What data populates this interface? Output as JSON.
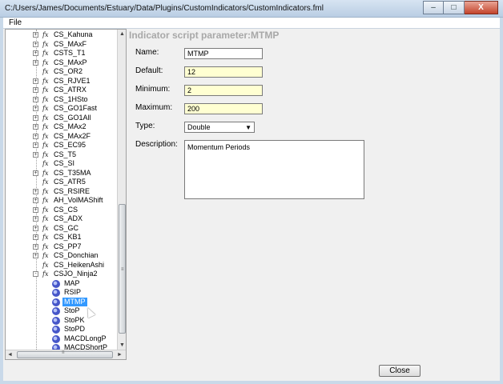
{
  "window": {
    "title": "C:/Users/James/Documents/Estuary/Data/Plugins/CustomIndicators/CustomIndicators.fml",
    "minimize_label": "–",
    "restore_label": "□",
    "close_label": "X"
  },
  "menu": {
    "file_label": "File"
  },
  "tree": {
    "items": [
      {
        "label": "CS_Kahuna",
        "expander": "+"
      },
      {
        "label": "CS_MAxF",
        "expander": "+"
      },
      {
        "label": "CSTS_T1",
        "expander": "+"
      },
      {
        "label": "CS_MAxP",
        "expander": "+"
      },
      {
        "label": "CS_OR2",
        "expander": ""
      },
      {
        "label": "CS_RJVE1",
        "expander": "+"
      },
      {
        "label": "CS_ATRX",
        "expander": "+"
      },
      {
        "label": "CS_1HSto",
        "expander": "+"
      },
      {
        "label": "CS_GO1Fast",
        "expander": "+"
      },
      {
        "label": "CS_GO1All",
        "expander": "+"
      },
      {
        "label": "CS_MAx2",
        "expander": "+"
      },
      {
        "label": "CS_MAx2F",
        "expander": "+"
      },
      {
        "label": "CS_EC95",
        "expander": "+"
      },
      {
        "label": "CS_T5",
        "expander": "+"
      },
      {
        "label": "CS_SI",
        "expander": ""
      },
      {
        "label": "CS_T35MA",
        "expander": "+"
      },
      {
        "label": "CS_ATR5",
        "expander": ""
      },
      {
        "label": "CS_RSIRE",
        "expander": "+"
      },
      {
        "label": "AH_VolMAShift",
        "expander": "+"
      },
      {
        "label": "CS_CS",
        "expander": "+"
      },
      {
        "label": "CS_ADX",
        "expander": "+"
      },
      {
        "label": "CS_GC",
        "expander": "+"
      },
      {
        "label": "CS_KB1",
        "expander": "+"
      },
      {
        "label": "CS_PP7",
        "expander": "+"
      },
      {
        "label": "CS_Donchian",
        "expander": "+"
      },
      {
        "label": "CS_HeikenAshi",
        "expander": ""
      },
      {
        "label": "CSJO_Ninja2",
        "expander": "-"
      }
    ],
    "children": [
      {
        "label": "MAP"
      },
      {
        "label": "RSIP"
      },
      {
        "label": "MTMP",
        "selected": true
      },
      {
        "label": "StoP"
      },
      {
        "label": "StoPK"
      },
      {
        "label": "StoPD"
      },
      {
        "label": "MACDLongP"
      },
      {
        "label": "MACDShortP"
      }
    ],
    "scroll_up": "▲",
    "scroll_down": "▼",
    "scroll_left": "◄",
    "scroll_right": "►",
    "grip": "≡"
  },
  "panel": {
    "title": "Indicator script parameter:MTMP",
    "name_label": "Name:",
    "name_value": "MTMP",
    "default_label": "Default:",
    "default_value": "12",
    "minimum_label": "Minimum:",
    "minimum_value": "2",
    "maximum_label": "Maximum:",
    "maximum_value": "200",
    "type_label": "Type:",
    "type_value": "Double",
    "description_label": "Description:",
    "description_value": "Momentum Periods"
  },
  "buttons": {
    "close_label": "Close"
  },
  "colors": {
    "selection": "#3399ff",
    "input_highlight": "#ffffd2",
    "title_gray": "#a8a8a8"
  }
}
